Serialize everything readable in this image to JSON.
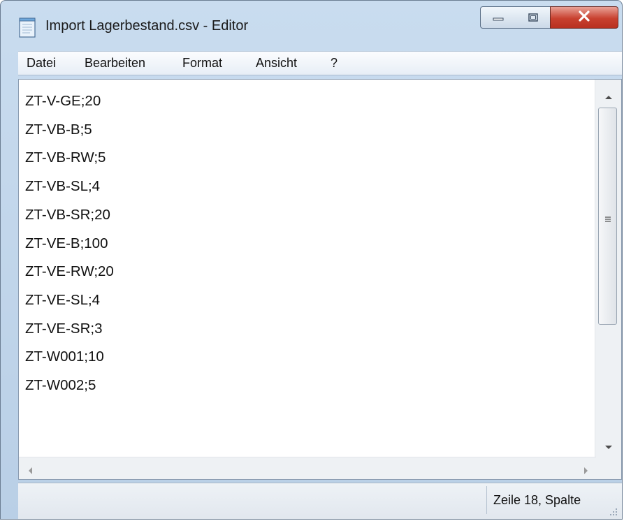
{
  "window": {
    "title": "Import Lagerbestand.csv - Editor",
    "icons": {
      "app": "notepad-icon",
      "minimize": "minimize-icon",
      "maximize": "maximize-icon",
      "close": "close-icon"
    }
  },
  "menu": {
    "items": [
      "Datei",
      "Bearbeiten",
      "Format",
      "Ansicht",
      "?"
    ]
  },
  "editor": {
    "lines": [
      "ZT-V-GE;20",
      "ZT-VB-B;5",
      "ZT-VB-RW;5",
      "ZT-VB-SL;4",
      "ZT-VB-SR;20",
      "ZT-VE-B;100",
      "ZT-VE-RW;20",
      "ZT-VE-SL;4",
      "ZT-VE-SR;3",
      "ZT-W001;10",
      "ZT-W002;5"
    ]
  },
  "status": {
    "position": "Zeile 18, Spalte"
  },
  "colors": {
    "close_button": "#c8412f",
    "frame": "#b9cfe6"
  }
}
